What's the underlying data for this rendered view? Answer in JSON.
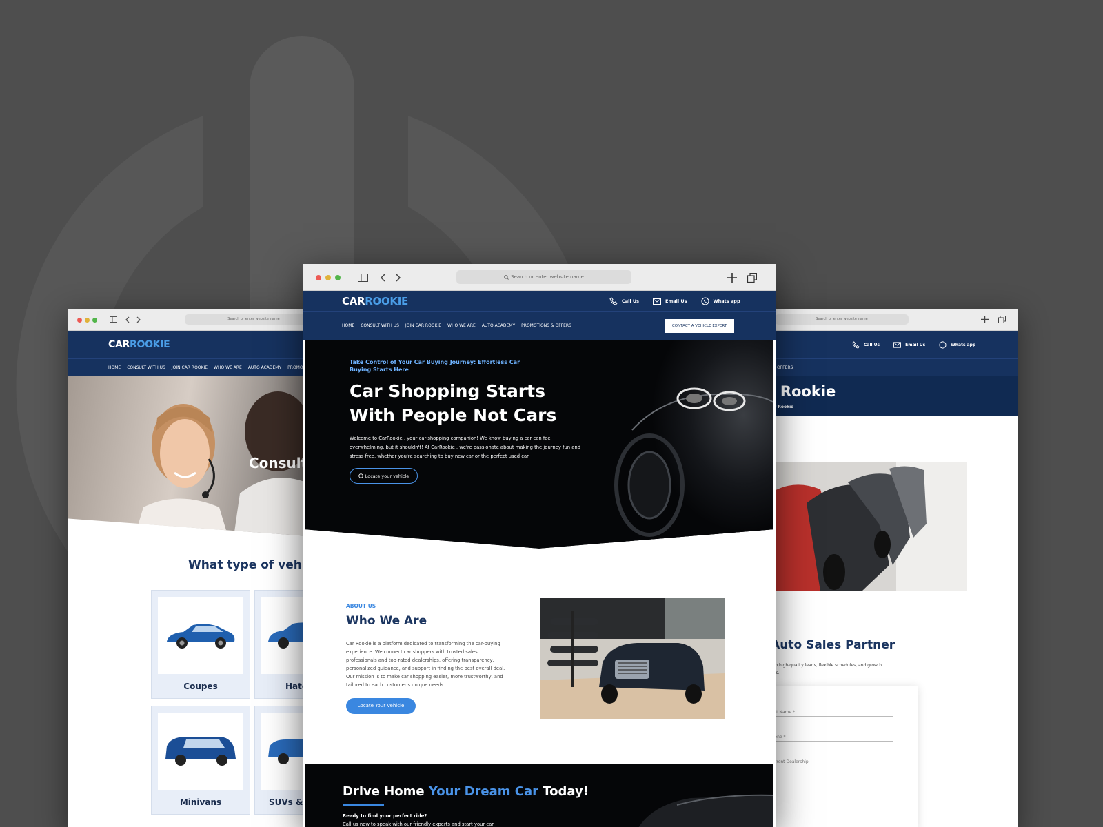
{
  "brand": {
    "name_part1": "CAR",
    "name_part2": "ROOKIE"
  },
  "colors": {
    "background": "#4e4e4e",
    "navy": "#16325f",
    "accent_blue": "#3a87e0",
    "hero_black": "#050608"
  },
  "browser": {
    "search_placeholder": "Search or enter website name"
  },
  "contact": {
    "call": "Call Us",
    "email": "Email Us",
    "whatsapp": "Whats app"
  },
  "nav": {
    "items": [
      "HOME",
      "CONSULT WITH US",
      "JOIN CAR ROOKIE",
      "WHO WE ARE",
      "AUTO ACADEMY",
      "PROMOTIONS & OFFERS"
    ],
    "cta": "CONTACT A VEHICLE EXPERT",
    "left_truncated": "PROMOTI",
    "right_truncated": "TIONS & OFFERS"
  },
  "left_window": {
    "hero_text": "Consult",
    "section_title": "What type of vehicle",
    "cards": [
      "Coupes",
      "Hatch",
      "Minivans",
      "SUVs & C"
    ]
  },
  "center_window": {
    "hero": {
      "eyebrow_line1": "Take Control of Your Car Buying Journey: Effortless Car",
      "eyebrow_line2": "Buying Starts Here",
      "title_line1": "Car Shopping Starts",
      "title_line2": "With People Not Cars",
      "body_line1": "Welcome to CarRookie , your car-shopping companion! We know buying a car can feel",
      "body_line2": "overwhelming, but it shouldn't! At CarRookie , we're passionate about making the journey fun and",
      "body_line3": "stress-free, whether you're searching to buy new car or the perfect used car.",
      "button": "Locate your vehicle"
    },
    "about": {
      "eyebrow": "ABOUT US",
      "title": "Who We Are",
      "body_line1": "Car Rookie is a platform dedicated to transforming the car-buying",
      "body_line2": "experience. We connect car shoppers with trusted sales",
      "body_line3": "professionals and top-rated dealerships, offering transparency,",
      "body_line4": "personalized guidance, and support in finding the best overall deal.",
      "body_line5": "Our mission is to make car shopping easier, more trustworthy, and",
      "body_line6": "tailored to each customer's unique needs.",
      "button": "Locate Your Vehicle"
    },
    "drive": {
      "title_a": "Drive Home ",
      "title_b": "Your Dream Car",
      "title_c": " Today!",
      "line1": "Ready to find your perfect ride?",
      "line2": "Call us now to speak with our friendly experts and start your car"
    }
  },
  "right_window": {
    "hero_title": "ar Rookie",
    "breadcrumb": "Join Car Rookie",
    "partner_title": "d Auto Sales Partner",
    "partner_line1": "access to high-quality leads, flexible schedules, and growth",
    "partner_line2": "ortunities.",
    "form": {
      "last_name": "Last Name *",
      "phone": "Phone *",
      "dealership": "Current Dealership"
    }
  }
}
